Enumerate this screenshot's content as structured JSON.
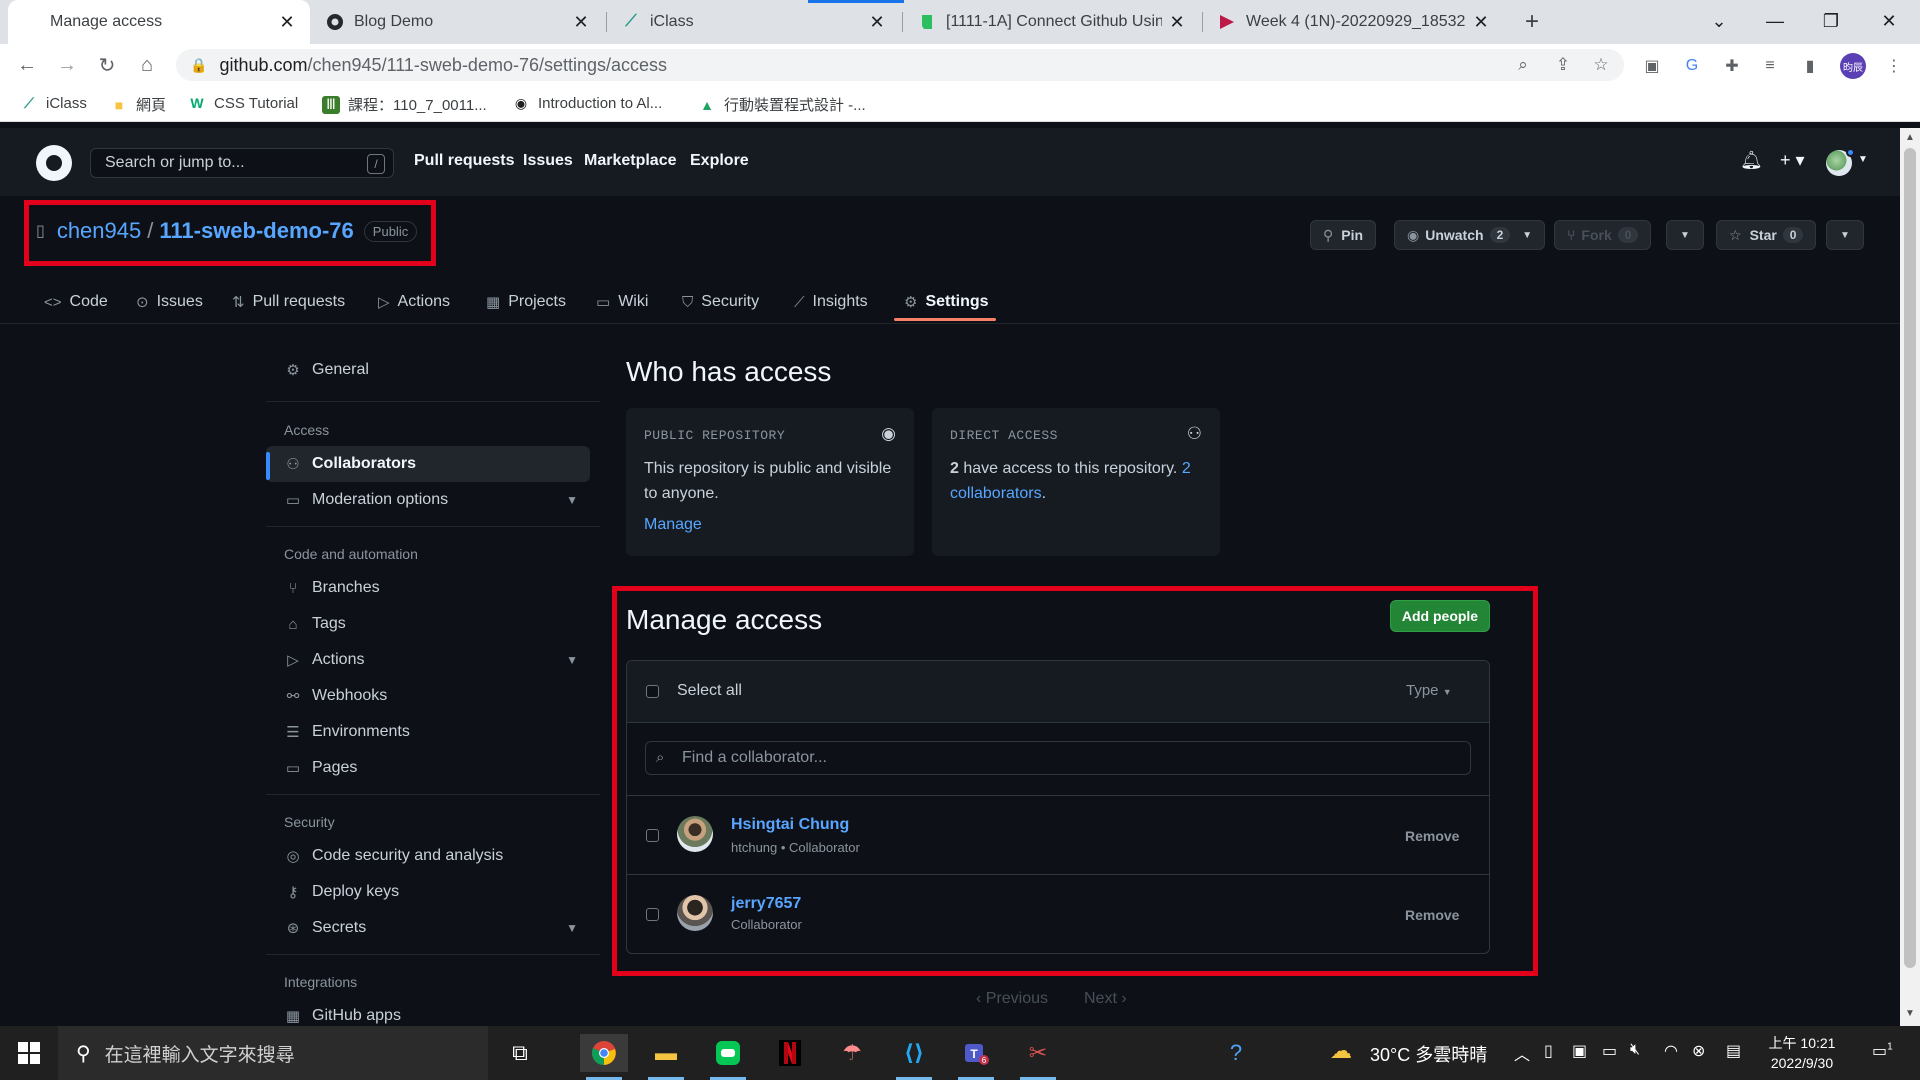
{
  "browser": {
    "tabs": [
      {
        "title": "Manage access",
        "active": true
      },
      {
        "title": "Blog Demo"
      },
      {
        "title": "iClass"
      },
      {
        "title": "[1111-1A] Connect Github Usin"
      },
      {
        "title": "Week 4 (1N)-20220929_18532"
      }
    ],
    "url_host": "github.com",
    "url_path": "/chen945/111-sweb-demo-76/settings/access",
    "profile_initials": "昀辰",
    "bookmarks": [
      {
        "label": "iClass"
      },
      {
        "label": "網頁"
      },
      {
        "label": "CSS Tutorial"
      },
      {
        "label": "課程：110_7_0011..."
      },
      {
        "label": "Introduction to Al..."
      },
      {
        "label": "行動裝置程式設計 -..."
      }
    ]
  },
  "github": {
    "search_placeholder": "Search or jump to...",
    "search_shortcut": "/",
    "nav": [
      "Pull requests",
      "Issues",
      "Marketplace",
      "Explore"
    ]
  },
  "repo": {
    "owner": "chen945",
    "separator": "/",
    "name": "111-sweb-demo-76",
    "visibility": "Public",
    "actions": {
      "pin": "Pin",
      "unwatch": "Unwatch",
      "unwatch_count": "2",
      "fork": "Fork",
      "fork_count": "0",
      "star": "Star",
      "star_count": "0"
    },
    "tabs": [
      "Code",
      "Issues",
      "Pull requests",
      "Actions",
      "Projects",
      "Wiki",
      "Security",
      "Insights",
      "Settings"
    ],
    "active_tab": "Settings"
  },
  "sidebar": {
    "general": "General",
    "access_heading": "Access",
    "access_items": [
      "Collaborators",
      "Moderation options"
    ],
    "code_heading": "Code and automation",
    "code_items": [
      "Branches",
      "Tags",
      "Actions",
      "Webhooks",
      "Environments",
      "Pages"
    ],
    "security_heading": "Security",
    "security_items": [
      "Code security and analysis",
      "Deploy keys",
      "Secrets"
    ],
    "integrations_heading": "Integrations",
    "integrations_items": [
      "GitHub apps"
    ]
  },
  "who_has_access": {
    "title": "Who has access",
    "public_card": {
      "label": "PUBLIC REPOSITORY",
      "text": "This repository is public and visible to anyone.",
      "link": "Manage"
    },
    "direct_card": {
      "label": "DIRECT ACCESS",
      "count": "2",
      "text": " have access to this repository. ",
      "link": "2 collaborators",
      "end": "."
    }
  },
  "manage_access": {
    "title": "Manage access",
    "add_button": "Add people",
    "select_all": "Select all",
    "type_filter": "Type",
    "find_placeholder": "Find a collaborator...",
    "collaborators": [
      {
        "name": "Hsingtai Chung",
        "subtitle": "htchung • Collaborator",
        "action": "Remove"
      },
      {
        "name": "jerry7657",
        "subtitle": "Collaborator",
        "action": "Remove"
      }
    ],
    "pagination": {
      "previous": "Previous",
      "next": "Next"
    }
  },
  "taskbar": {
    "search_placeholder": "在這裡輸入文字來搜尋",
    "weather": "30°C 多雲時晴",
    "time": "上午 10:21",
    "date": "2022/9/30",
    "notification_count": "1"
  },
  "colors": {
    "accent_blue": "#58a6ff",
    "success_green": "#238636",
    "highlight_red": "#e3001b",
    "active_tab_underline": "#f78166"
  }
}
